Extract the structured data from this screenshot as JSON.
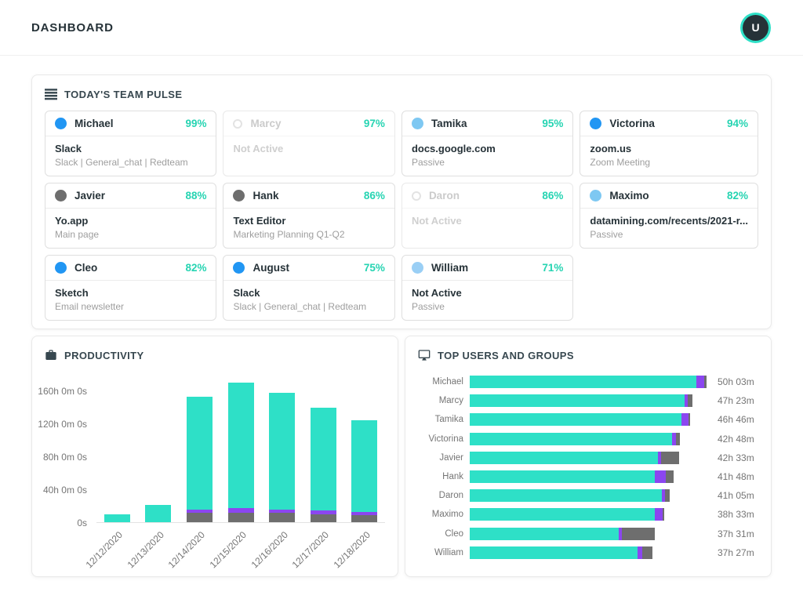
{
  "header": {
    "title": "DASHBOARD",
    "avatar_initial": "U"
  },
  "icons": {
    "team_pulse": "list-icon",
    "productivity": "briefcase-icon",
    "top_users": "monitor-icon",
    "avatar": "user-avatar"
  },
  "colors": {
    "accent_teal_bar": "#2EE0C7",
    "accent_purple_bar": "#8B46F0",
    "accent_gray_bar": "#6E6E6E",
    "percent_text": "#26D4B2",
    "avatar_ring": "#2EE0C7",
    "avatar_bg": "#263238"
  },
  "team_pulse": {
    "title": "TODAY'S TEAM PULSE",
    "cards": [
      {
        "name": "Michael",
        "percent": "99%",
        "active": true,
        "dot_color": "#2196F3",
        "line1": "Slack",
        "line2": "Slack | General_chat | Redteam"
      },
      {
        "name": "Marcy",
        "percent": "97%",
        "active": false,
        "dot_color": "",
        "line1": "Not Active",
        "line2": ""
      },
      {
        "name": "Tamika",
        "percent": "95%",
        "active": true,
        "dot_color": "#7EC8F2",
        "line1": "docs.google.com",
        "line2": "Passive"
      },
      {
        "name": "Victorina",
        "percent": "94%",
        "active": true,
        "dot_color": "#2196F3",
        "line1": "zoom.us",
        "line2": "Zoom Meeting"
      },
      {
        "name": "Javier",
        "percent": "88%",
        "active": true,
        "dot_color": "#6E6E6E",
        "line1": "Yo.app",
        "line2": "Main page"
      },
      {
        "name": "Hank",
        "percent": "86%",
        "active": true,
        "dot_color": "#6E6E6E",
        "line1": "Text Editor",
        "line2": "Marketing Planning Q1-Q2"
      },
      {
        "name": "Daron",
        "percent": "86%",
        "active": false,
        "dot_color": "",
        "line1": "Not Active",
        "line2": ""
      },
      {
        "name": "Maximo",
        "percent": "82%",
        "active": true,
        "dot_color": "#7EC8F2",
        "line1": "datamining.com/recents/2021-r...",
        "line2": "Passive"
      },
      {
        "name": "Cleo",
        "percent": "82%",
        "active": true,
        "dot_color": "#2196F3",
        "line1": "Sketch",
        "line2": "Email newsletter"
      },
      {
        "name": "August",
        "percent": "75%",
        "active": true,
        "dot_color": "#2196F3",
        "line1": "Slack",
        "line2": "Slack | General_chat | Redteam"
      },
      {
        "name": "William",
        "percent": "71%",
        "active": true,
        "dot_color": "#9ACFF5",
        "line1": "Not Active",
        "line2": "Passive"
      }
    ]
  },
  "chart_data": [
    {
      "type": "bar",
      "stacked": true,
      "title": "PRODUCTIVITY",
      "categories": [
        "12/12/2020",
        "12/13/2020",
        "12/14/2020",
        "12/15/2020",
        "12/16/2020",
        "12/17/2020",
        "12/18/2020"
      ],
      "series": [
        {
          "name": "gray",
          "color": "#6E6E6E",
          "values_hours": [
            0,
            0,
            11,
            11,
            11,
            10,
            9
          ]
        },
        {
          "name": "purple",
          "color": "#8B46F0",
          "values_hours": [
            0,
            0,
            4,
            6,
            4,
            4,
            3
          ]
        },
        {
          "name": "teal",
          "color": "#2EE0C7",
          "values_hours": [
            10,
            21,
            137,
            153,
            142,
            125,
            112
          ]
        }
      ],
      "totals_hours": [
        10,
        21,
        152,
        170,
        157,
        139,
        124
      ],
      "yticks": [
        {
          "label": "0s",
          "value": 0
        },
        {
          "label": "40h 0m 0s",
          "value": 40
        },
        {
          "label": "80h 0m 0s",
          "value": 80
        },
        {
          "label": "120h 0m 0s",
          "value": 120
        },
        {
          "label": "160h 0m 0s",
          "value": 160
        }
      ],
      "ylim_hours": [
        0,
        173
      ],
      "grid": false,
      "legend": "none"
    },
    {
      "type": "horizontal-bar",
      "stacked": true,
      "title": "TOP USERS AND GROUPS",
      "colors": {
        "teal": "#2EE0C7",
        "purple": "#8B46F0",
        "gray": "#6E6E6E"
      },
      "legend": "none",
      "rows": [
        {
          "name": "Michael",
          "value_label": "50h 03m",
          "segments_pct": {
            "teal": 95.6,
            "purple": 3.3,
            "gray": 1.0
          }
        },
        {
          "name": "Marcy",
          "value_label": "47h 23m",
          "segments_pct": {
            "teal": 90.6,
            "purple": 1.5,
            "gray": 2.1
          }
        },
        {
          "name": "Tamika",
          "value_label": "46h 46m",
          "segments_pct": {
            "teal": 89.5,
            "purple": 2.8,
            "gray": 0.6
          }
        },
        {
          "name": "Victorina",
          "value_label": "42h 48m",
          "segments_pct": {
            "teal": 85.4,
            "purple": 1.6,
            "gray": 1.9
          }
        },
        {
          "name": "Javier",
          "value_label": "42h 33m",
          "segments_pct": {
            "teal": 79.4,
            "purple": 1.3,
            "gray": 7.6
          }
        },
        {
          "name": "Hank",
          "value_label": "41h 48m",
          "segments_pct": {
            "teal": 78.2,
            "purple": 4.6,
            "gray": 3.2
          }
        },
        {
          "name": "Daron",
          "value_label": "41h 05m",
          "segments_pct": {
            "teal": 81.0,
            "purple": 1.3,
            "gray": 2.0
          }
        },
        {
          "name": "Maximo",
          "value_label": "38h 33m",
          "segments_pct": {
            "teal": 78.3,
            "purple": 3.3,
            "gray": 0.4
          }
        },
        {
          "name": "Cleo",
          "value_label": "37h 31m",
          "segments_pct": {
            "teal": 63.0,
            "purple": 1.3,
            "gray": 13.8
          }
        },
        {
          "name": "William",
          "value_label": "37h 27m",
          "segments_pct": {
            "teal": 70.7,
            "purple": 2.2,
            "gray": 4.2
          }
        }
      ]
    }
  ]
}
